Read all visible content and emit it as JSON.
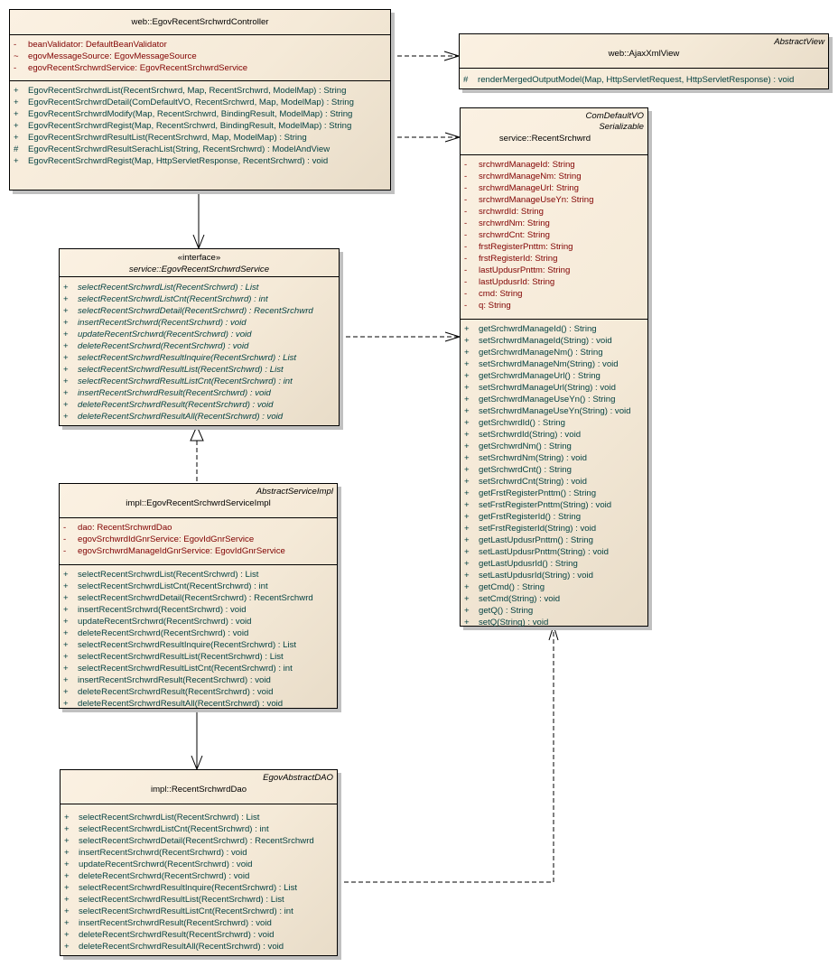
{
  "classes": {
    "controller": {
      "name": "web::EgovRecentSrchwrdController",
      "attributes": [
        {
          "vis": "-",
          "text": "beanValidator:  DefaultBeanValidator"
        },
        {
          "vis": "~",
          "text": "egovMessageSource:  EgovMessageSource"
        },
        {
          "vis": "-",
          "text": "egovRecentSrchwrdService:  EgovRecentSrchwrdService"
        }
      ],
      "operations": [
        {
          "vis": "+",
          "text": "EgovRecentSrchwrdList(RecentSrchwrd, Map, RecentSrchwrd, ModelMap) : String"
        },
        {
          "vis": "+",
          "text": "EgovRecentSrchwrdDetail(ComDefaultVO, RecentSrchwrd, Map, ModelMap) : String"
        },
        {
          "vis": "+",
          "text": "EgovRecentSrchwrdModify(Map, RecentSrchwrd, BindingResult, ModelMap) : String"
        },
        {
          "vis": "+",
          "text": "EgovRecentSrchwrdRegist(Map, RecentSrchwrd, BindingResult, ModelMap) : String"
        },
        {
          "vis": "+",
          "text": "EgovRecentSrchwrdResultList(RecentSrchwrd, Map, ModelMap) : String"
        },
        {
          "vis": "#",
          "text": "EgovRecentSrchwrdResultSerachList(String, RecentSrchwrd) : ModelAndView"
        },
        {
          "vis": "+",
          "text": "EgovRecentSrchwrdRegist(Map, HttpServletResponse, RecentSrchwrd) : void"
        }
      ]
    },
    "ajaxView": {
      "stereotype": "AbstractView",
      "name": "web::AjaxXmlView",
      "operations": [
        {
          "vis": "#",
          "text": "renderMergedOutputModel(Map, HttpServletRequest, HttpServletResponse) : void"
        }
      ]
    },
    "recentSrchwrd": {
      "stereotypes": [
        "ComDefaultVO",
        "Serializable"
      ],
      "name": "service::RecentSrchwrd",
      "attributes": [
        {
          "vis": "-",
          "text": "srchwrdManageId:  String"
        },
        {
          "vis": "-",
          "text": "srchwrdManageNm:  String"
        },
        {
          "vis": "-",
          "text": "srchwrdManageUrl:  String"
        },
        {
          "vis": "-",
          "text": "srchwrdManageUseYn:  String"
        },
        {
          "vis": "-",
          "text": "srchwrdId:  String"
        },
        {
          "vis": "-",
          "text": "srchwrdNm:  String"
        },
        {
          "vis": "-",
          "text": "srchwrdCnt:  String"
        },
        {
          "vis": "-",
          "text": "frstRegisterPnttm:  String"
        },
        {
          "vis": "-",
          "text": "frstRegisterId:  String"
        },
        {
          "vis": "-",
          "text": "lastUpdusrPnttm:  String"
        },
        {
          "vis": "-",
          "text": "lastUpdusrId:  String"
        },
        {
          "vis": "-",
          "text": "cmd:  String"
        },
        {
          "vis": "-",
          "text": "q:  String"
        }
      ],
      "operations": [
        {
          "vis": "+",
          "text": "getSrchwrdManageId() : String"
        },
        {
          "vis": "+",
          "text": "setSrchwrdManageId(String) : void"
        },
        {
          "vis": "+",
          "text": "getSrchwrdManageNm() : String"
        },
        {
          "vis": "+",
          "text": "setSrchwrdManageNm(String) : void"
        },
        {
          "vis": "+",
          "text": "getSrchwrdManageUrl() : String"
        },
        {
          "vis": "+",
          "text": "setSrchwrdManageUrl(String) : void"
        },
        {
          "vis": "+",
          "text": "getSrchwrdManageUseYn() : String"
        },
        {
          "vis": "+",
          "text": "setSrchwrdManageUseYn(String) : void"
        },
        {
          "vis": "+",
          "text": "getSrchwrdId() : String"
        },
        {
          "vis": "+",
          "text": "setSrchwrdId(String) : void"
        },
        {
          "vis": "+",
          "text": "getSrchwrdNm() : String"
        },
        {
          "vis": "+",
          "text": "setSrchwrdNm(String) : void"
        },
        {
          "vis": "+",
          "text": "getSrchwrdCnt() : String"
        },
        {
          "vis": "+",
          "text": "setSrchwrdCnt(String) : void"
        },
        {
          "vis": "+",
          "text": "getFrstRegisterPnttm() : String"
        },
        {
          "vis": "+",
          "text": "setFrstRegisterPnttm(String) : void"
        },
        {
          "vis": "+",
          "text": "getFrstRegisterId() : String"
        },
        {
          "vis": "+",
          "text": "setFrstRegisterId(String) : void"
        },
        {
          "vis": "+",
          "text": "getLastUpdusrPnttm() : String"
        },
        {
          "vis": "+",
          "text": "setLastUpdusrPnttm(String) : void"
        },
        {
          "vis": "+",
          "text": "getLastUpdusrId() : String"
        },
        {
          "vis": "+",
          "text": "setLastUpdusrId(String) : void"
        },
        {
          "vis": "+",
          "text": "getCmd() : String"
        },
        {
          "vis": "+",
          "text": "setCmd(String) : void"
        },
        {
          "vis": "+",
          "text": "getQ() : String"
        },
        {
          "vis": "+",
          "text": "setQ(String) : void"
        }
      ]
    },
    "serviceInterface": {
      "stereotype": "«interface»",
      "name": "service::EgovRecentSrchwrdService",
      "operations": [
        {
          "vis": "+",
          "text": "selectRecentSrchwrdList(RecentSrchwrd) : List"
        },
        {
          "vis": "+",
          "text": "selectRecentSrchwrdListCnt(RecentSrchwrd) : int"
        },
        {
          "vis": "+",
          "text": "selectRecentSrchwrdDetail(RecentSrchwrd) : RecentSrchwrd"
        },
        {
          "vis": "+",
          "text": "insertRecentSrchwrd(RecentSrchwrd) : void"
        },
        {
          "vis": "+",
          "text": "updateRecentSrchwrd(RecentSrchwrd) : void"
        },
        {
          "vis": "+",
          "text": "deleteRecentSrchwrd(RecentSrchwrd) : void"
        },
        {
          "vis": "+",
          "text": "selectRecentSrchwrdResultInquire(RecentSrchwrd) : List"
        },
        {
          "vis": "+",
          "text": "selectRecentSrchwrdResultList(RecentSrchwrd) : List"
        },
        {
          "vis": "+",
          "text": "selectRecentSrchwrdResultListCnt(RecentSrchwrd) : int"
        },
        {
          "vis": "+",
          "text": "insertRecentSrchwrdResult(RecentSrchwrd) : void"
        },
        {
          "vis": "+",
          "text": "deleteRecentSrchwrdResult(RecentSrchwrd) : void"
        },
        {
          "vis": "+",
          "text": "deleteRecentSrchwrdResultAll(RecentSrchwrd) : void"
        }
      ]
    },
    "serviceImpl": {
      "stereotype": "AbstractServiceImpl",
      "name": "impl::EgovRecentSrchwrdServiceImpl",
      "attributes": [
        {
          "vis": "-",
          "text": "dao:  RecentSrchwrdDao"
        },
        {
          "vis": "-",
          "text": "egovSrchwrdIdGnrService:  EgovIdGnrService"
        },
        {
          "vis": "-",
          "text": "egovSrchwrdManageIdGnrService:  EgovIdGnrService"
        }
      ],
      "operations": [
        {
          "vis": "+",
          "text": "selectRecentSrchwrdList(RecentSrchwrd) : List"
        },
        {
          "vis": "+",
          "text": "selectRecentSrchwrdListCnt(RecentSrchwrd) : int"
        },
        {
          "vis": "+",
          "text": "selectRecentSrchwrdDetail(RecentSrchwrd) : RecentSrchwrd"
        },
        {
          "vis": "+",
          "text": "insertRecentSrchwrd(RecentSrchwrd) : void"
        },
        {
          "vis": "+",
          "text": "updateRecentSrchwrd(RecentSrchwrd) : void"
        },
        {
          "vis": "+",
          "text": "deleteRecentSrchwrd(RecentSrchwrd) : void"
        },
        {
          "vis": "+",
          "text": "selectRecentSrchwrdResultInquire(RecentSrchwrd) : List"
        },
        {
          "vis": "+",
          "text": "selectRecentSrchwrdResultList(RecentSrchwrd) : List"
        },
        {
          "vis": "+",
          "text": "selectRecentSrchwrdResultListCnt(RecentSrchwrd) : int"
        },
        {
          "vis": "+",
          "text": "insertRecentSrchwrdResult(RecentSrchwrd) : void"
        },
        {
          "vis": "+",
          "text": "deleteRecentSrchwrdResult(RecentSrchwrd) : void"
        },
        {
          "vis": "+",
          "text": "deleteRecentSrchwrdResultAll(RecentSrchwrd) : void"
        }
      ]
    },
    "dao": {
      "stereotype": "EgovAbstractDAO",
      "name": "impl::RecentSrchwrdDao",
      "operations": [
        {
          "vis": "+",
          "text": "selectRecentSrchwrdList(RecentSrchwrd) : List"
        },
        {
          "vis": "+",
          "text": "selectRecentSrchwrdListCnt(RecentSrchwrd) : int"
        },
        {
          "vis": "+",
          "text": "selectRecentSrchwrdDetail(RecentSrchwrd) : RecentSrchwrd"
        },
        {
          "vis": "+",
          "text": "insertRecentSrchwrd(RecentSrchwrd) : void"
        },
        {
          "vis": "+",
          "text": "updateRecentSrchwrd(RecentSrchwrd) : void"
        },
        {
          "vis": "+",
          "text": "deleteRecentSrchwrd(RecentSrchwrd) : void"
        },
        {
          "vis": "+",
          "text": "selectRecentSrchwrdResultInquire(RecentSrchwrd) : List"
        },
        {
          "vis": "+",
          "text": "selectRecentSrchwrdResultList(RecentSrchwrd) : List"
        },
        {
          "vis": "+",
          "text": "selectRecentSrchwrdResultListCnt(RecentSrchwrd) : int"
        },
        {
          "vis": "+",
          "text": "insertRecentSrchwrdResult(RecentSrchwrd) : void"
        },
        {
          "vis": "+",
          "text": "deleteRecentSrchwrdResult(RecentSrchwrd) : void"
        },
        {
          "vis": "+",
          "text": "deleteRecentSrchwrdResultAll(RecentSrchwrd) : void"
        }
      ]
    }
  },
  "relationships": [
    {
      "from": "web::EgovRecentSrchwrdController",
      "to": "web::AjaxXmlView",
      "type": "dependency"
    },
    {
      "from": "web::EgovRecentSrchwrdController",
      "to": "service::RecentSrchwrd",
      "type": "dependency"
    },
    {
      "from": "web::EgovRecentSrchwrdController",
      "to": "service::EgovRecentSrchwrdService",
      "type": "association"
    },
    {
      "from": "service::EgovRecentSrchwrdService",
      "to": "service::RecentSrchwrd",
      "type": "dependency"
    },
    {
      "from": "impl::EgovRecentSrchwrdServiceImpl",
      "to": "service::EgovRecentSrchwrdService",
      "type": "realization"
    },
    {
      "from": "impl::EgovRecentSrchwrdServiceImpl",
      "to": "impl::RecentSrchwrdDao",
      "type": "association"
    },
    {
      "from": "impl::RecentSrchwrdDao",
      "to": "service::RecentSrchwrd",
      "type": "dependency"
    }
  ],
  "colors": {
    "attribute_text": "#800000",
    "operation_text": "#003f3f",
    "box_fill": "#f5ead8",
    "border": "#000000",
    "shadow": "#c0c0c0"
  }
}
